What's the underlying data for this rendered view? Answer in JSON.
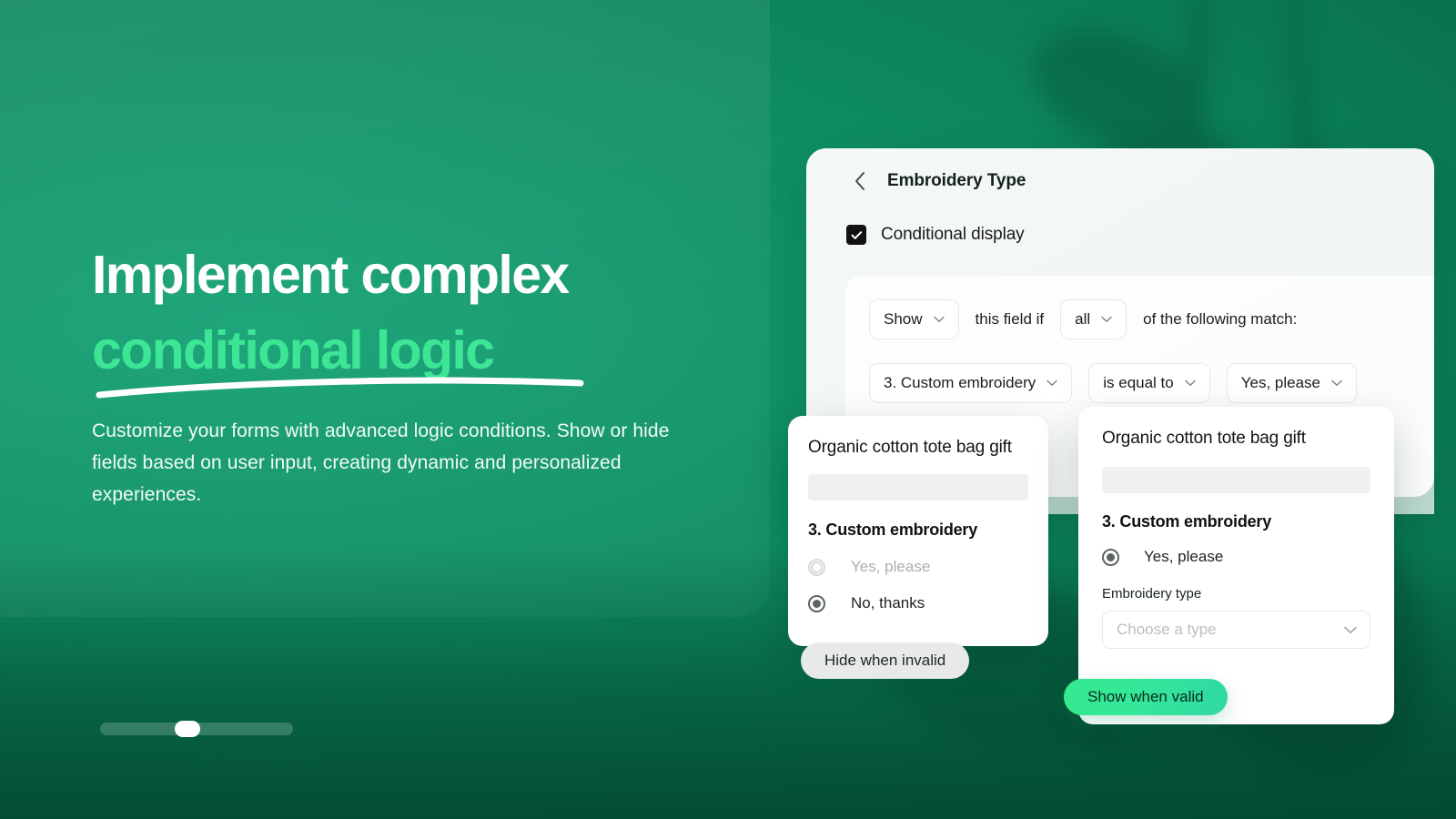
{
  "hero": {
    "headline_line1": "Implement complex",
    "headline_line2": "conditional logic",
    "subcopy": "Customize your forms with advanced logic conditions. Show or hide fields based on user input, creating dynamic and personalized experiences.",
    "accent_color": "#3ce695",
    "text_color": "#ffffff",
    "background_color": "#0e8c63"
  },
  "carousel": {
    "slides_total": 3,
    "active_slide": 2,
    "track_color": "#3a8f73",
    "thumb_color": "#ffffff"
  },
  "settings_panel": {
    "back_icon": "chevron-left-icon",
    "title": "Embroidery Type",
    "conditional_display": {
      "label": "Conditional display",
      "checked": true,
      "check_icon": "checkmark-icon"
    },
    "rule_builder": {
      "action_select": {
        "value": "Show",
        "icon": "chevron-down-icon"
      },
      "text_after_action": "this field if",
      "match_select": {
        "value": "all",
        "icon": "chevron-down-icon"
      },
      "text_after_match": "of the following match:",
      "condition": {
        "field_select": {
          "value": "3. Custom embroidery",
          "icon": "chevron-down-icon"
        },
        "operator_select": {
          "value": "is equal to",
          "icon": "chevron-down-icon"
        },
        "value_select": {
          "value": "Yes, please",
          "icon": "chevron-down-icon"
        }
      }
    }
  },
  "preview_invalid": {
    "title": "Organic cotton tote bag gift",
    "question": "3. Custom embroidery",
    "options": [
      {
        "label": "Yes, please",
        "selected": false
      },
      {
        "label": "No, thanks",
        "selected": true
      }
    ],
    "badge": {
      "label": "Hide when invalid",
      "background": "#e8eae9",
      "color": "#1e2724"
    }
  },
  "preview_valid": {
    "title": "Organic cotton tote bag gift",
    "question": "3. Custom embroidery",
    "options": [
      {
        "label": "Yes, please",
        "selected": true
      }
    ],
    "conditional_field": {
      "label": "Embroidery type",
      "placeholder": "Choose a type",
      "icon": "chevron-down-icon"
    },
    "badge": {
      "label": "Show  when valid",
      "background": "#35e98e",
      "color": "#0c2a1c"
    }
  }
}
